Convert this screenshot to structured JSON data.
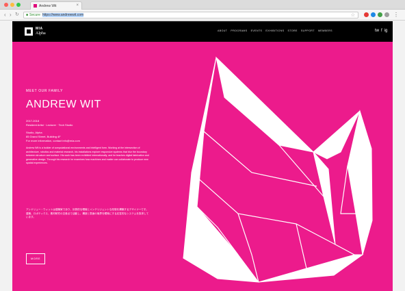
{
  "browser": {
    "tab_title": "Andrew Wit",
    "tab_close": "×",
    "back_icon": "‹",
    "forward_icon": "›",
    "reload_icon": "↻",
    "secure_icon": "🔒",
    "url_secure_label": "Secure",
    "url": "https://www.andrewwit.com"
  },
  "site": {
    "logo_line1": "MIA",
    "logo_line2": "Alpha",
    "menu": [
      "ABOUT",
      "PROGRAMS",
      "EVENTS",
      "EXHIBITIONS",
      "STORE",
      "SUPPORT",
      "MEMBERS"
    ],
    "social": [
      "tw",
      "f",
      "ig"
    ],
    "kicker": "MEET OUR FAMILY",
    "artist_name": "ANDREW WIT",
    "dates": "2017-2018",
    "residence_note": "Resident Artist · Lecturer · Tech Studio",
    "studio_name": "Studio, Alpha",
    "studio_address": "85 Grand Street, Building 4F",
    "studio_contact": "For more information, contact info@mia.com",
    "bio_en": "Andrew Wit is a builder of computational environments and intelligent form. Working at the intersection of architecture, robotics and material research, his installations explore responsive systems that blur the boundary between structure and surface. His work has been exhibited internationally, and he teaches digital fabrication and generative design. Through his research he examines how machines and matter can collaborate to produce new spatial experiences.",
    "bio_jp": "アンドリュー・ウィットは建築家であり、計算的な環境とインテリジェントな形態を構築するデザイナーです。建築、ロボティクス、素材研究の交差点で活動し、構造と表面の境界を曖昧にする応答的なシステムを探求しています。",
    "button_label": "MORE"
  }
}
